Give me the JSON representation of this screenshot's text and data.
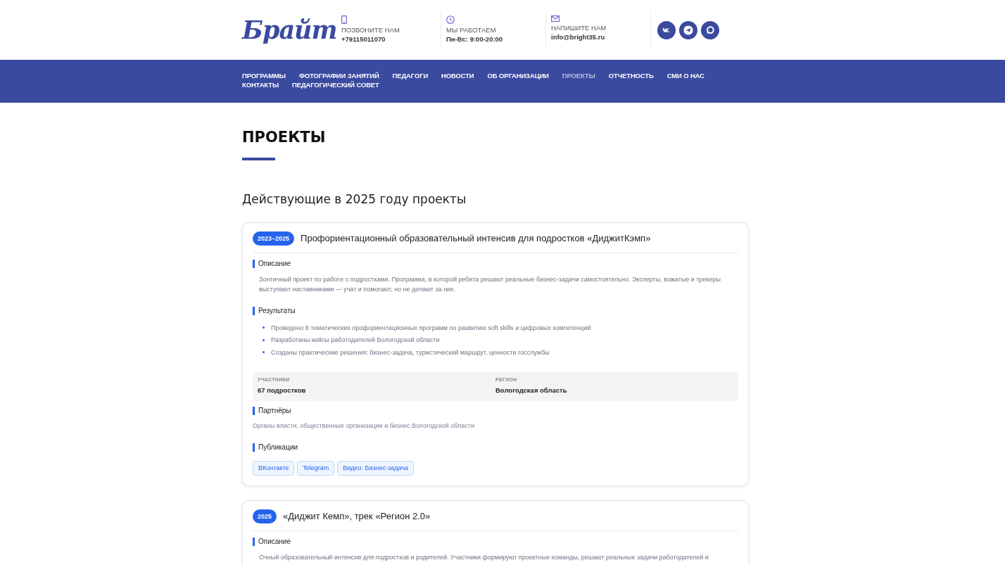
{
  "header": {
    "logo": "Брайт",
    "contacts": [
      {
        "kind": "phone",
        "label": "ПОЗВОНИТЕ НАМ",
        "value": "+79115011070"
      },
      {
        "kind": "clock",
        "label": "МЫ РАБОТАЕМ",
        "value": "Пн-Вс: 9:00-20:00"
      },
      {
        "kind": "mail",
        "label": "НАПИШИТЕ НАМ",
        "value": "info@bright35.ru"
      }
    ],
    "socials": [
      {
        "kind": "vk"
      },
      {
        "kind": "telegram"
      },
      {
        "kind": "chat"
      }
    ]
  },
  "nav": [
    {
      "label": "ПРОГРАММЫ",
      "selected": false
    },
    {
      "label": "ФОТОГРАФИИ ЗАНЯТИЙ",
      "selected": false
    },
    {
      "label": "ПЕДАГОГИ",
      "selected": false
    },
    {
      "label": "НОВОСТИ",
      "selected": false
    },
    {
      "label": "ОБ ОРГАНИЗАЦИИ",
      "selected": false
    },
    {
      "label": "ПРОЕКТЫ",
      "selected": true
    },
    {
      "label": "ОТЧЕТНОСТЬ",
      "selected": false
    },
    {
      "label": "СМИ О НАС",
      "selected": false
    },
    {
      "label": "КОНТАКТЫ",
      "selected": false
    },
    {
      "label": "ПЕДАГОГИЧЕСКИЙ СОВЕТ",
      "selected": false
    }
  ],
  "page_title": "ПРОЕКТЫ",
  "section_title": "Действующие в 2025 году проекты",
  "projects": [
    {
      "years": "2023–2025",
      "title": "Профориентационный образовательный интенсив для подростков «ДиджитКэмп»",
      "sections": [
        {
          "kind": "text",
          "heading": "Описание",
          "text": "Зонтичный проект по работе с подростками. Программа, в которой ребята решают реальные бизнес-задачи самостоятельно. Эксперты, вожатые и трекеры выступают наставниками — учат и помогают, но не делают за них."
        },
        {
          "kind": "list",
          "heading": "Результаты",
          "items": [
            "Проведено 8 тематических профориентационных программ по развитию soft skills и цифровых компетенций",
            "Разработаны кейсы работодателей Вологодской области",
            "Созданы практические решения: бизнес-задача, туристический маршрут, ценности госслужбы"
          ]
        },
        {
          "kind": "stats",
          "stats": [
            {
              "label": "УЧАСТНИКИ",
              "value": "67 подростков"
            },
            {
              "label": "РЕГИОН",
              "value": "Вологодская область"
            }
          ]
        },
        {
          "kind": "note",
          "heading": "Партнёры",
          "text": "Органы власти, общественные организации и бизнес Вологодской области"
        },
        {
          "kind": "links",
          "heading": "Публикации",
          "links": [
            "ВКонтакте",
            "Telegram",
            "Видео: Бизнес-задача"
          ]
        }
      ]
    },
    {
      "years": "2025",
      "title": "«Диджит Кемп», трек «Регион 2.0»",
      "sections": [
        {
          "kind": "text",
          "heading": "Описание",
          "text": "Очный образовательный интенсив для подростков и родителей. Участники формируют проектные команды, решают реальные задачи работодателей и"
        }
      ]
    }
  ]
}
